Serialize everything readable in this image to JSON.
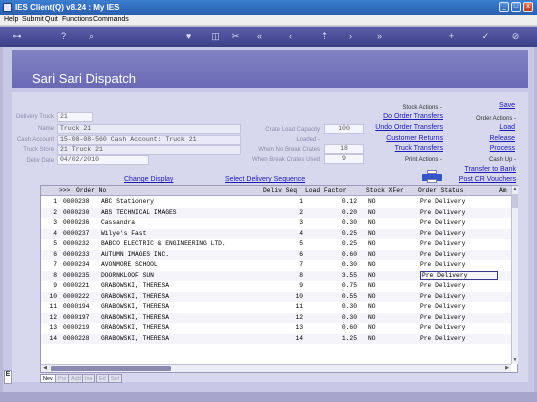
{
  "window": {
    "title": "IES Client(Q) v8.24 : My IES",
    "minimize": "_",
    "maximize": "□",
    "close": "x"
  },
  "menu": [
    "Help",
    "Submit",
    "Quit",
    "Functions",
    "Commands"
  ],
  "banner": {
    "title": "Sari Sari Dispatch"
  },
  "form": {
    "delivery_truck_label": "Delivery Truck",
    "delivery_truck": "21",
    "name_label": "Name",
    "name": "Truck 21",
    "cash_account_label": "Cash Account",
    "cash_account": "15-08-08-560 Cash Account: Truck 21",
    "truck_store_label": "Truck Store",
    "truck_store": "21 Truck 21",
    "deliv_date_label": "Deliv Date",
    "deliv_date": "04/02/2010",
    "crate_load_capacity_label": "Crate Load Capacity",
    "crate_load_capacity": "100",
    "loaded_label": "Loaded -",
    "when_no_break_crates_label": "When No Break Crates",
    "when_no_break_crates": "18",
    "when_break_crates_used_label": "When Break Crates Used",
    "when_break_crates_used": "9"
  },
  "actions": {
    "stock_actions_label": "Stock Actions -",
    "do_order_transfers": "Do Order Transfers",
    "undo_order_transfers": "Undo Order Transfers",
    "customer_returns": "Customer Returns",
    "truck_transfers": "Truck Transfers",
    "print_actions_label": "Print Actions -",
    "save": "Save",
    "order_actions_label": "Order Actions -",
    "load": "Load",
    "release": "Release",
    "process": "Process",
    "cash_up_label": "Cash Up -",
    "transfer_to_bank": "Transfer to Bank",
    "post_cr_vouchers": "Post CR Vouchers",
    "change_display": "Change Display",
    "select_delivery_sequence": "Select Delivery Sequence"
  },
  "grid": {
    "headers": {
      "rownum": ">>>",
      "order_no": "Order No",
      "deliv_seq": "Deliv Seq",
      "load_factor": "Load Factor",
      "stock_xfer": "Stock XFer",
      "order_status": "Order Status",
      "am": "Am"
    },
    "rows": [
      {
        "n": "1",
        "order_no": "0000238",
        "customer": "ABC Stationery",
        "deliv_seq": "1",
        "load_factor": "0.12",
        "stock_xfer": "NO",
        "order_status": "Pre Delivery"
      },
      {
        "n": "2",
        "order_no": "0000230",
        "customer": "ABS TECHNICAL IMAGES",
        "deliv_seq": "2",
        "load_factor": "0.20",
        "stock_xfer": "NO",
        "order_status": "Pre Delivery"
      },
      {
        "n": "3",
        "order_no": "0000236",
        "customer": "Cassandra",
        "deliv_seq": "3",
        "load_factor": "0.30",
        "stock_xfer": "NO",
        "order_status": "Pre Delivery"
      },
      {
        "n": "4",
        "order_no": "0000237",
        "customer": "Wilye's Fast",
        "deliv_seq": "4",
        "load_factor": "0.25",
        "stock_xfer": "NO",
        "order_status": "Pre Delivery"
      },
      {
        "n": "5",
        "order_no": "0000232",
        "customer": "BABCO ELECTRIC & ENGINEERING LTD.",
        "deliv_seq": "5",
        "load_factor": "0.25",
        "stock_xfer": "NO",
        "order_status": "Pre Delivery"
      },
      {
        "n": "6",
        "order_no": "0000233",
        "customer": "AUTUMN IMAGES INC.",
        "deliv_seq": "6",
        "load_factor": "0.60",
        "stock_xfer": "NO",
        "order_status": "Pre Delivery"
      },
      {
        "n": "7",
        "order_no": "0000234",
        "customer": "AVONMORE SCHOOL",
        "deliv_seq": "7",
        "load_factor": "0.30",
        "stock_xfer": "NO",
        "order_status": "Pre Delivery"
      },
      {
        "n": "8",
        "order_no": "0000235",
        "customer": "DOORNKLOOF SUN",
        "deliv_seq": "8",
        "load_factor": "3.55",
        "stock_xfer": "NO",
        "order_status": "Pre Delivery"
      },
      {
        "n": "9",
        "order_no": "0000221",
        "customer": "GRABOWSKI, THERESA",
        "deliv_seq": "9",
        "load_factor": "0.75",
        "stock_xfer": "NO",
        "order_status": "Pre Delivery"
      },
      {
        "n": "10",
        "order_no": "0000222",
        "customer": "GRABOWSKI, THERESA",
        "deliv_seq": "10",
        "load_factor": "0.55",
        "stock_xfer": "NO",
        "order_status": "Pre Delivery"
      },
      {
        "n": "11",
        "order_no": "0000194",
        "customer": "GRABOWSKI, THERESA",
        "deliv_seq": "11",
        "load_factor": "0.30",
        "stock_xfer": "NO",
        "order_status": "Pre Delivery"
      },
      {
        "n": "12",
        "order_no": "0000197",
        "customer": "GRABOWSKI, THERESA",
        "deliv_seq": "12",
        "load_factor": "0.30",
        "stock_xfer": "NO",
        "order_status": "Pre Delivery"
      },
      {
        "n": "13",
        "order_no": "0000219",
        "customer": "GRABOWSKI, THERESA",
        "deliv_seq": "13",
        "load_factor": "0.60",
        "stock_xfer": "NO",
        "order_status": "Pre Delivery"
      },
      {
        "n": "14",
        "order_no": "0000228",
        "customer": "GRABOWSKI, THERESA",
        "deliv_seq": "14",
        "load_factor": "1.25",
        "stock_xfer": "NO",
        "order_status": "Pre Delivery"
      }
    ]
  },
  "tabs": [
    "Nev",
    "Pre",
    "Add",
    "Ins",
    "Ed",
    "Sel"
  ],
  "left_stub": "E"
}
